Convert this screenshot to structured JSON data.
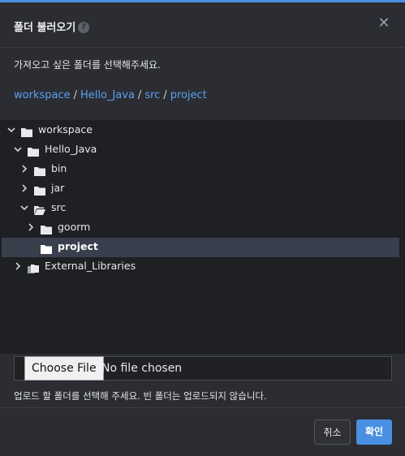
{
  "dialog": {
    "title": "폴더 불러오기",
    "help_glyph": "?",
    "close_glyph": "✕",
    "description": "가져오고 싶은 폴더를 선택해주세요."
  },
  "breadcrumb": {
    "items": [
      "workspace",
      "Hello_Java",
      "src",
      "project"
    ],
    "separator": "/"
  },
  "tree": {
    "nodes": [
      {
        "label": "workspace",
        "caret": "down",
        "icon": "folder-icon"
      },
      {
        "label": "Hello_Java",
        "caret": "down",
        "icon": "folder-icon"
      },
      {
        "label": "bin",
        "caret": "right",
        "icon": "folder-icon"
      },
      {
        "label": "jar",
        "caret": "right",
        "icon": "folder-icon"
      },
      {
        "label": "src",
        "caret": "down",
        "icon": "folder-open-icon"
      },
      {
        "label": "goorm",
        "caret": "right",
        "icon": "folder-icon"
      },
      {
        "label": "project",
        "caret": "none",
        "icon": "folder-icon",
        "selected": true
      },
      {
        "label": "External_Libraries",
        "caret": "right",
        "icon": "library-icon"
      }
    ]
  },
  "upload": {
    "choose_label": "Choose File",
    "status": "No file chosen",
    "hint": "업로드 할 폴더를 선택해 주세요. 빈 폴더는 업로드되지 않습니다."
  },
  "footer": {
    "cancel_label": "취소",
    "confirm_label": "확인"
  },
  "colors": {
    "accent": "#4a90e2",
    "link": "#5aa0f0",
    "selection": "#3a3f4d"
  }
}
